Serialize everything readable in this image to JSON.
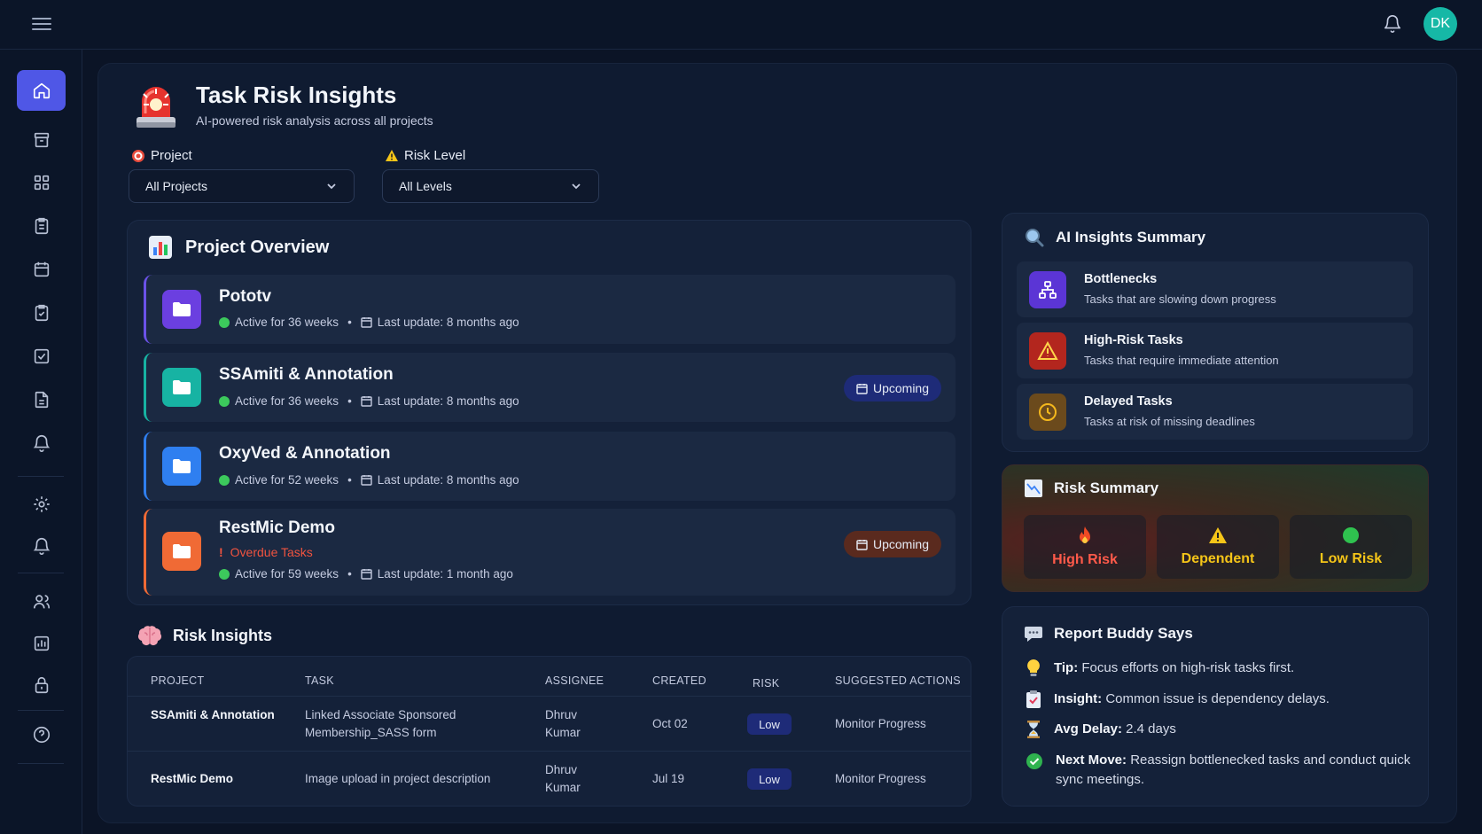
{
  "header": {
    "avatar_initials": "DK"
  },
  "page": {
    "title": "Task Risk Insights",
    "subtitle": "AI-powered risk analysis across all projects"
  },
  "filters": {
    "project_label": "Project",
    "project_value": "All Projects",
    "risk_label": "Risk Level",
    "risk_value": "All Levels"
  },
  "overview": {
    "title": "Project Overview",
    "projects": [
      {
        "name": "Pototv",
        "active": "Active for 36 weeks",
        "updated": "Last update: 8 months ago",
        "badge": "",
        "color": "#6b3fe0"
      },
      {
        "name": "SSAmiti & Annotation",
        "active": "Active for 36 weeks",
        "updated": "Last update: 8 months ago",
        "badge": "Upcoming",
        "color": "#17b3a3"
      },
      {
        "name": "OxyVed & Annotation",
        "active": "Active for 52 weeks",
        "updated": "Last update: 8 months ago",
        "badge": "",
        "color": "#2f7ff0"
      },
      {
        "name": "RestMic Demo",
        "active": "Active for 59 weeks",
        "updated": "Last update: 1 month ago",
        "badge": "Upcoming",
        "overdue": "Overdue Tasks",
        "color": "#f06a35"
      }
    ]
  },
  "risk_insights": {
    "title": "Risk Insights",
    "columns": [
      "PROJECT",
      "TASK",
      "ASSIGNEE",
      "CREATED",
      "RISK",
      "SUGGESTED ACTIONS"
    ],
    "rows": [
      {
        "project": "SSAmiti & Annotation",
        "task": "Linked Associate Sponsored Membership_SASS form",
        "assignee": "Dhruv Kumar",
        "created": "Oct 02",
        "risk": "Low",
        "action": "Monitor Progress"
      },
      {
        "project": "RestMic Demo",
        "task": "Image upload in project description",
        "assignee": "Dhruv Kumar",
        "created": "Jul 19",
        "risk": "Low",
        "action": "Monitor Progress"
      }
    ]
  },
  "ai_summary": {
    "title": "AI Insights Summary",
    "items": [
      {
        "title": "Bottlenecks",
        "desc": "Tasks that are slowing down progress"
      },
      {
        "title": "High-Risk Tasks",
        "desc": "Tasks that require immediate attention"
      },
      {
        "title": "Delayed Tasks",
        "desc": "Tasks at risk of missing deadlines"
      }
    ]
  },
  "risk_summary": {
    "title": "Risk Summary",
    "high": "High Risk",
    "dependent": "Dependent",
    "low": "Low Risk"
  },
  "buddy": {
    "title": "Report Buddy Says",
    "lines": [
      {
        "label": "Tip:",
        "text": "Focus efforts on high-risk tasks first."
      },
      {
        "label": "Insight:",
        "text": "Common issue is dependency delays."
      },
      {
        "label": "Avg Delay:",
        "text": "2.4 days"
      },
      {
        "label": "Next Move:",
        "text": "Reassign bottlenecked tasks and conduct quick sync meetings."
      }
    ]
  },
  "colors": {
    "accent": "#4f57e6",
    "background": "#0b1426",
    "panel": "#142139"
  }
}
